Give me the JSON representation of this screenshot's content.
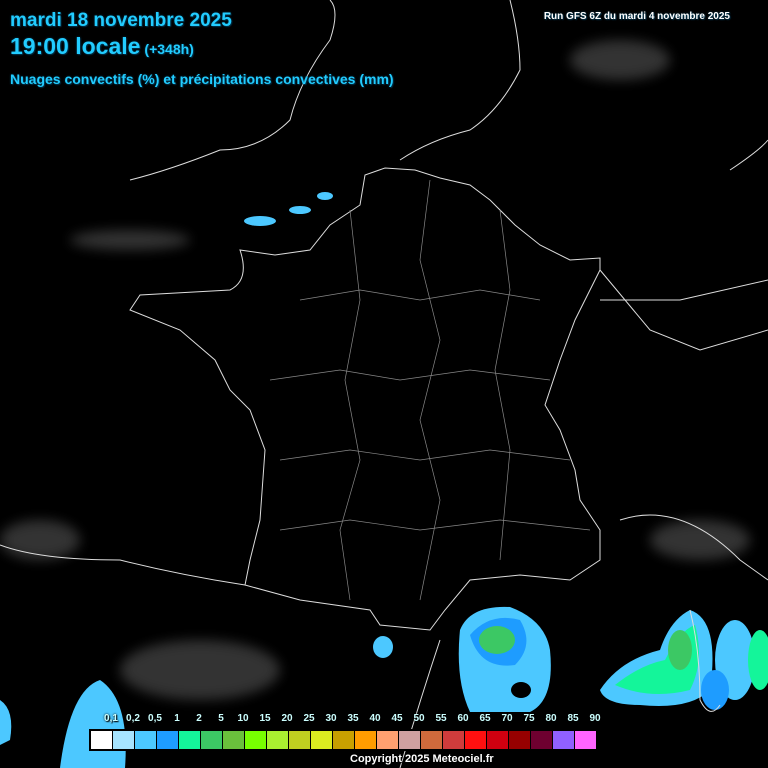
{
  "header": {
    "date": "mardi 18 novembre 2025",
    "time": "19:00 locale",
    "lead": "(+348h)",
    "subtitle": "Nuages convectifs (%) et précipitations convectives (mm)",
    "run": "Run GFS 6Z du mardi 4 novembre 2025"
  },
  "legend": {
    "labels": [
      "0,1",
      "0,2",
      "0,5",
      "1",
      "2",
      "5",
      "10",
      "15",
      "20",
      "25",
      "30",
      "35",
      "40",
      "45",
      "50",
      "55",
      "60",
      "65",
      "70",
      "75",
      "80",
      "85",
      "90"
    ],
    "colors": [
      "#ffffff",
      "#a6e4ff",
      "#4cc8ff",
      "#1e9cff",
      "#14f59a",
      "#3cc864",
      "#6ac03c",
      "#78ff00",
      "#aaf030",
      "#c0d020",
      "#dcec20",
      "#c8a000",
      "#ff9c00",
      "#ffa070",
      "#d0a0a0",
      "#d06a3c",
      "#d03c3c",
      "#ff1010",
      "#d00010",
      "#960000",
      "#6e0030",
      "#9060ff",
      "#ff64ff"
    ]
  },
  "copyright": "Copyright 2025 Meteociel.fr"
}
